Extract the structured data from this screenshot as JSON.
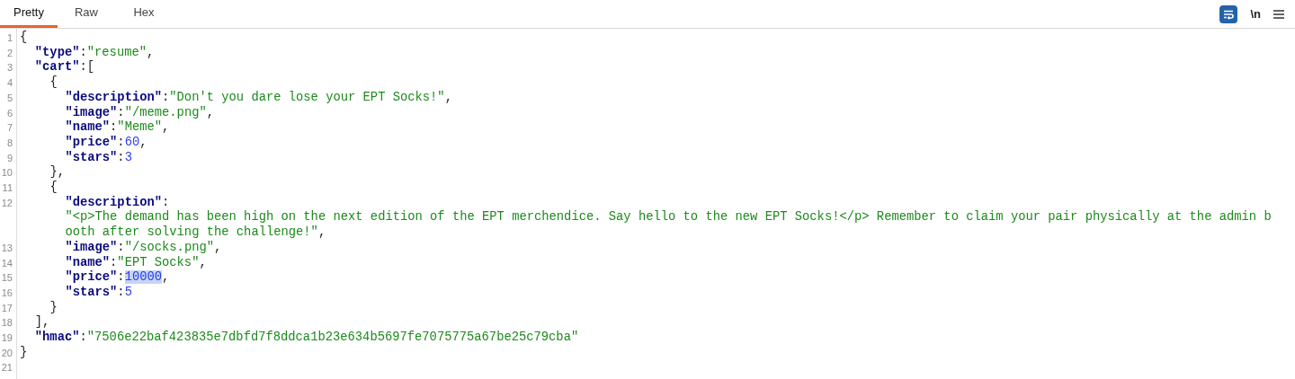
{
  "tabs": [
    {
      "label": "Pretty",
      "selected": true
    },
    {
      "label": "Raw",
      "selected": false
    },
    {
      "label": "Hex",
      "selected": false
    }
  ],
  "toolbar": {
    "wrap_on": true,
    "newline_label": "\\n"
  },
  "lines": [
    {
      "number": "1",
      "tokens": [
        {
          "kind": "p",
          "text": "{",
          "selected": false
        }
      ]
    },
    {
      "number": "2",
      "tokens": [
        {
          "kind": "k",
          "text": "\"type\"",
          "selected": false
        },
        {
          "kind": "p",
          "text": ":",
          "selected": false
        },
        {
          "kind": "s",
          "text": "\"resume\"",
          "selected": false
        },
        {
          "kind": "p",
          "text": ",",
          "selected": false
        }
      ]
    },
    {
      "number": "3",
      "tokens": [
        {
          "kind": "k",
          "text": "\"cart\"",
          "selected": false
        },
        {
          "kind": "p",
          "text": ":[",
          "selected": false
        }
      ]
    },
    {
      "number": "4",
      "tokens": [
        {
          "kind": "p",
          "text": "{",
          "selected": false
        }
      ]
    },
    {
      "number": "5",
      "tokens": [
        {
          "kind": "k",
          "text": "\"description\"",
          "selected": false
        },
        {
          "kind": "p",
          "text": ":",
          "selected": false
        },
        {
          "kind": "s",
          "text": "\"Don't you dare lose your EPT Socks!\"",
          "selected": false
        },
        {
          "kind": "p",
          "text": ",",
          "selected": false
        }
      ]
    },
    {
      "number": "6",
      "tokens": [
        {
          "kind": "k",
          "text": "\"image\"",
          "selected": false
        },
        {
          "kind": "p",
          "text": ":",
          "selected": false
        },
        {
          "kind": "s",
          "text": "\"/meme.png\"",
          "selected": false
        },
        {
          "kind": "p",
          "text": ",",
          "selected": false
        }
      ]
    },
    {
      "number": "7",
      "tokens": [
        {
          "kind": "k",
          "text": "\"name\"",
          "selected": false
        },
        {
          "kind": "p",
          "text": ":",
          "selected": false
        },
        {
          "kind": "s",
          "text": "\"Meme\"",
          "selected": false
        },
        {
          "kind": "p",
          "text": ",",
          "selected": false
        }
      ]
    },
    {
      "number": "8",
      "tokens": [
        {
          "kind": "k",
          "text": "\"price\"",
          "selected": false
        },
        {
          "kind": "p",
          "text": ":",
          "selected": false
        },
        {
          "kind": "n",
          "text": "60",
          "selected": false
        },
        {
          "kind": "p",
          "text": ",",
          "selected": false
        }
      ]
    },
    {
      "number": "9",
      "tokens": [
        {
          "kind": "k",
          "text": "\"stars\"",
          "selected": false
        },
        {
          "kind": "p",
          "text": ":",
          "selected": false
        },
        {
          "kind": "n",
          "text": "3",
          "selected": false
        }
      ]
    },
    {
      "number": "10",
      "tokens": [
        {
          "kind": "p",
          "text": "},",
          "selected": false
        }
      ]
    },
    {
      "number": "11",
      "tokens": [
        {
          "kind": "p",
          "text": "{",
          "selected": false
        }
      ]
    },
    {
      "number": "12",
      "tokens": [
        {
          "kind": "k",
          "text": "\"description\"",
          "selected": false
        },
        {
          "kind": "p",
          "text": ":",
          "selected": false
        }
      ]
    },
    {
      "tokens": [
        {
          "kind": "s",
          "text": "\"<p>The demand has been high on the next edition of the EPT merchendice. Say hello to the new EPT Socks!</p> Remember to claim your pair physically at the admin b",
          "selected": false
        }
      ]
    },
    {
      "tokens": [
        {
          "kind": "s",
          "text": "ooth after solving the challenge!\"",
          "selected": false
        },
        {
          "kind": "p",
          "text": ",",
          "selected": false
        }
      ]
    },
    {
      "number": "13",
      "tokens": [
        {
          "kind": "k",
          "text": "\"image\"",
          "selected": false
        },
        {
          "kind": "p",
          "text": ":",
          "selected": false
        },
        {
          "kind": "s",
          "text": "\"/socks.png\"",
          "selected": false
        },
        {
          "kind": "p",
          "text": ",",
          "selected": false
        }
      ]
    },
    {
      "number": "14",
      "tokens": [
        {
          "kind": "k",
          "text": "\"name\"",
          "selected": false
        },
        {
          "kind": "p",
          "text": ":",
          "selected": false
        },
        {
          "kind": "s",
          "text": "\"EPT Socks\"",
          "selected": false
        },
        {
          "kind": "p",
          "text": ",",
          "selected": false
        }
      ]
    },
    {
      "number": "15",
      "tokens": [
        {
          "kind": "k",
          "text": "\"price\"",
          "selected": false
        },
        {
          "kind": "p",
          "text": ":",
          "selected": false
        },
        {
          "kind": "n",
          "text": "10000",
          "selected": true
        },
        {
          "kind": "p",
          "text": ",",
          "selected": false
        }
      ]
    },
    {
      "number": "16",
      "tokens": [
        {
          "kind": "k",
          "text": "\"stars\"",
          "selected": false
        },
        {
          "kind": "p",
          "text": ":",
          "selected": false
        },
        {
          "kind": "n",
          "text": "5",
          "selected": false
        }
      ]
    },
    {
      "number": "17",
      "tokens": [
        {
          "kind": "p",
          "text": "}",
          "selected": false
        }
      ]
    },
    {
      "number": "18",
      "tokens": [
        {
          "kind": "p",
          "text": "],",
          "selected": false
        }
      ]
    },
    {
      "number": "19",
      "tokens": [
        {
          "kind": "k",
          "text": "\"hmac\"",
          "selected": false
        },
        {
          "kind": "p",
          "text": ":",
          "selected": false
        },
        {
          "kind": "s",
          "text": "\"7506e22baf423835e7dbfd7f8ddca1b23e634b5697fe7075775a67be25c79cba\"",
          "selected": false
        }
      ]
    },
    {
      "number": "20",
      "tokens": [
        {
          "kind": "p",
          "text": "}",
          "selected": false
        }
      ]
    },
    {
      "number": "21"
    }
  ]
}
